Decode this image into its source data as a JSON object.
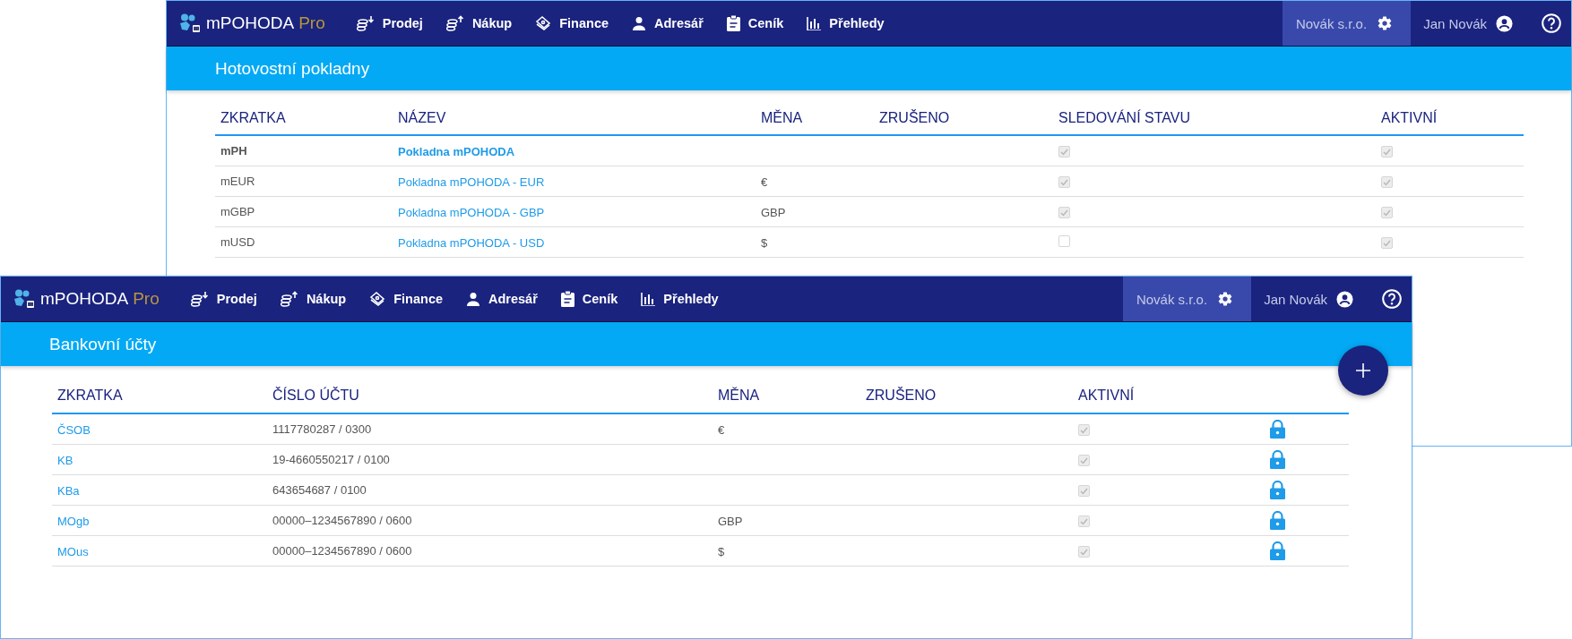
{
  "windows": [
    {
      "kind": "cash",
      "app": {
        "name": "mPOHODA",
        "edition": "Pro"
      },
      "nav": [
        {
          "kind": "sales",
          "label": "Prodej"
        },
        {
          "kind": "purchase",
          "label": "Nákup"
        },
        {
          "kind": "finance",
          "label": "Finance"
        },
        {
          "kind": "contacts",
          "label": "Adresář"
        },
        {
          "kind": "pricelist",
          "label": "Ceník"
        },
        {
          "kind": "reports",
          "label": "Přehledy"
        }
      ],
      "company": "Novák s.r.o.",
      "user": "Jan Novák",
      "title": "Hotovostní pokladny",
      "columns": [
        "ZKRATKA",
        "NÁZEV",
        "MĚNA",
        "ZRUŠENO",
        "SLEDOVÁNÍ STAVU",
        "AKTIVNÍ"
      ],
      "rows": [
        {
          "code": "mPH",
          "name": "Pokladna mPOHODA",
          "primary": true,
          "tracking": true,
          "active": true
        },
        {
          "code": "mEUR",
          "name": "Pokladna mPOHODA - EUR",
          "currency": "€",
          "primary": false,
          "tracking": true,
          "active": true
        },
        {
          "code": "mGBP",
          "name": "Pokladna mPOHODA - GBP",
          "currency": "GBP",
          "primary": false,
          "tracking": true,
          "active": true
        },
        {
          "code": "mUSD",
          "name": "Pokladna mPOHODA - USD",
          "currency": "$",
          "primary": false,
          "tracking": false,
          "active": true
        }
      ]
    },
    {
      "kind": "bank",
      "app": {
        "name": "mPOHODA",
        "edition": "Pro"
      },
      "nav": [
        {
          "kind": "sales",
          "label": "Prodej"
        },
        {
          "kind": "purchase",
          "label": "Nákup"
        },
        {
          "kind": "finance",
          "label": "Finance"
        },
        {
          "kind": "contacts",
          "label": "Adresář"
        },
        {
          "kind": "pricelist",
          "label": "Ceník"
        },
        {
          "kind": "reports",
          "label": "Přehledy"
        }
      ],
      "company": "Novák s.r.o.",
      "user": "Jan Novák",
      "title": "Bankovní účty",
      "columns": [
        "ZKRATKA",
        "ČÍSLO ÚČTU",
        "MĚNA",
        "ZRUŠENO",
        "AKTIVNÍ"
      ],
      "rows": [
        {
          "code": "ČSOB",
          "account": "1117780287 / 0300",
          "currency": "€",
          "active": true
        },
        {
          "code": "KB",
          "account": "19-4660550217 / 0100",
          "active": true
        },
        {
          "code": "KBa",
          "account": "643654687 / 0100",
          "active": true
        },
        {
          "code": "MOgb",
          "account": "00000–1234567890 / 0600",
          "currency": "GBP",
          "active": true
        },
        {
          "code": "MOus",
          "account": "00000–1234567890 / 0600",
          "currency": "$",
          "active": true
        }
      ]
    }
  ]
}
